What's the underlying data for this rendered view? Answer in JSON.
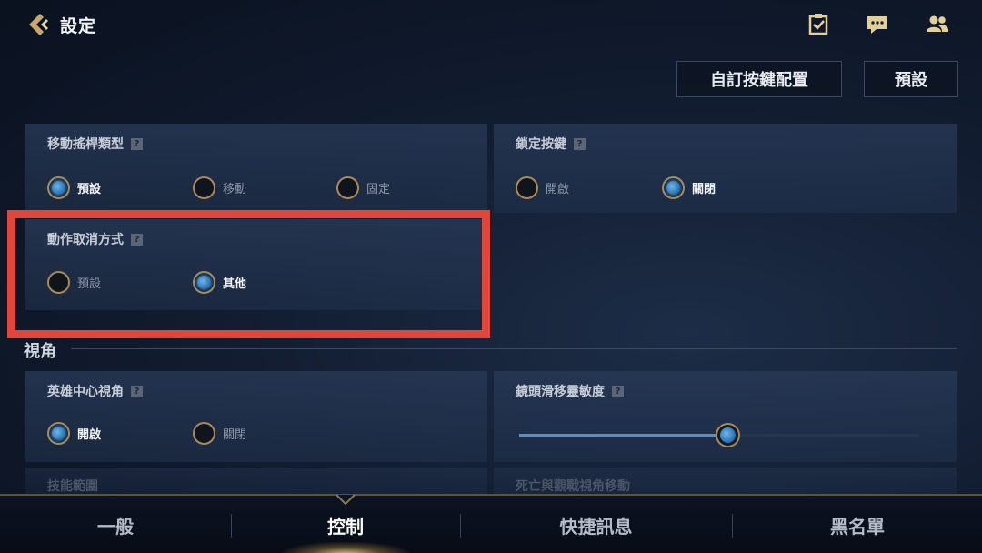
{
  "header": {
    "title": "設定",
    "icons": [
      "back-chevron-icon",
      "clipboard-check-icon",
      "chat-bubble-icon",
      "friends-icon"
    ]
  },
  "top_buttons": {
    "custom_keys": "自訂按鍵配置",
    "default": "預設"
  },
  "panels": {
    "joystick": {
      "title": "移動搖桿類型",
      "options": [
        {
          "label": "預設",
          "selected": true
        },
        {
          "label": "移動",
          "selected": false
        },
        {
          "label": "固定",
          "selected": false
        }
      ]
    },
    "lock_key": {
      "title": "鎖定按鍵",
      "options": [
        {
          "label": "開啟",
          "selected": false
        },
        {
          "label": "關閉",
          "selected": true
        }
      ]
    },
    "cancel_method": {
      "title": "動作取消方式",
      "options": [
        {
          "label": "預設",
          "selected": false
        },
        {
          "label": "其他",
          "selected": true
        }
      ]
    },
    "hero_camera": {
      "title": "英雄中心視角",
      "options": [
        {
          "label": "開啟",
          "selected": true
        },
        {
          "label": "關閉",
          "selected": false
        }
      ]
    },
    "camera_sensitivity": {
      "title": "鏡頭滑移靈敏度",
      "value": 0.52
    }
  },
  "section": {
    "title": "視角"
  },
  "faded_rows": {
    "left": "技能範圍",
    "right": "死亡與觀戰視角移動"
  },
  "tabs": [
    {
      "label": "一般",
      "active": false
    },
    {
      "label": "控制",
      "active": true
    },
    {
      "label": "快捷訊息",
      "active": false
    },
    {
      "label": "黑名單",
      "active": false
    }
  ],
  "colors": {
    "highlight_border": "#e1463a",
    "accent_gold": "#a98b56",
    "accent_blue": "#4f90cf"
  }
}
